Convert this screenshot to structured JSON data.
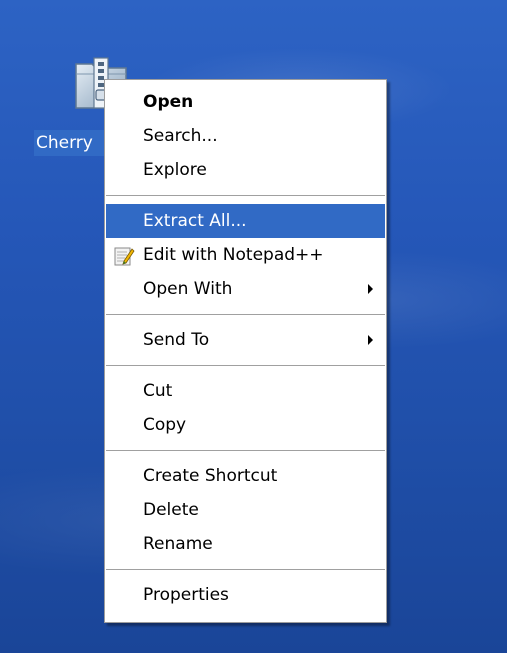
{
  "desktop": {
    "icon_label": "Cherry",
    "icon_name": "zip-folder-icon"
  },
  "context_menu": {
    "open": "Open",
    "search": "Search...",
    "explore": "Explore",
    "extract_all": "Extract All...",
    "edit_notepad": "Edit with Notepad++",
    "open_with": "Open With",
    "send_to": "Send To",
    "cut": "Cut",
    "copy": "Copy",
    "create_shortcut": "Create Shortcut",
    "delete": "Delete",
    "rename": "Rename",
    "properties": "Properties",
    "highlighted_item": "Extract All..."
  },
  "colors": {
    "desktop_background": "#2557b8",
    "selection": "#316ac5",
    "menu_background": "#ffffff"
  }
}
